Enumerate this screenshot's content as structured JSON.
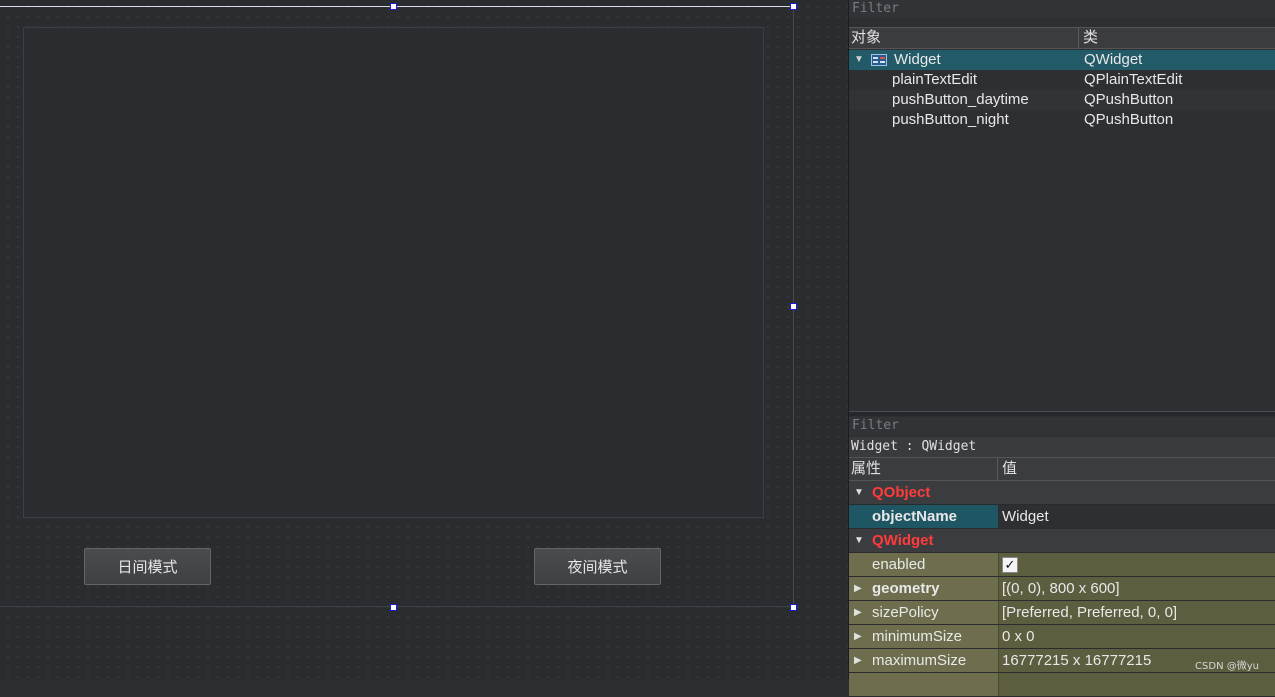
{
  "form": {
    "buttons": {
      "daytime": "日间模式",
      "night": "夜间模式"
    }
  },
  "object_inspector": {
    "filter_placeholder": "Filter",
    "columns": {
      "object": "对象",
      "class": "类"
    },
    "rows": [
      {
        "name": "Widget",
        "class": "QWidget"
      },
      {
        "name": "plainTextEdit",
        "class": "QPlainTextEdit"
      },
      {
        "name": "pushButton_daytime",
        "class": "QPushButton"
      },
      {
        "name": "pushButton_night",
        "class": "QPushButton"
      }
    ]
  },
  "property_editor": {
    "filter_placeholder": "Filter",
    "context": "Widget : QWidget",
    "columns": {
      "property": "属性",
      "value": "值"
    },
    "groups": {
      "qobject": "QObject",
      "qwidget": "QWidget"
    },
    "properties": {
      "objectName": {
        "name": "objectName",
        "value": "Widget"
      },
      "enabled": {
        "name": "enabled",
        "value": "✓"
      },
      "geometry": {
        "name": "geometry",
        "value": "[(0, 0), 800 x 600]"
      },
      "sizePolicy": {
        "name": "sizePolicy",
        "value": "[Preferred, Preferred, 0, 0]"
      },
      "minimumSize": {
        "name": "minimumSize",
        "value": "0 x 0"
      },
      "maximumSize": {
        "name": "maximumSize",
        "value": "16777215 x 16777215"
      }
    }
  },
  "watermark": "CSDN @微yu",
  "colors": {
    "selection": "#235a68",
    "group_header": "#ff3b3b",
    "property_row": "#6e6e4e"
  }
}
